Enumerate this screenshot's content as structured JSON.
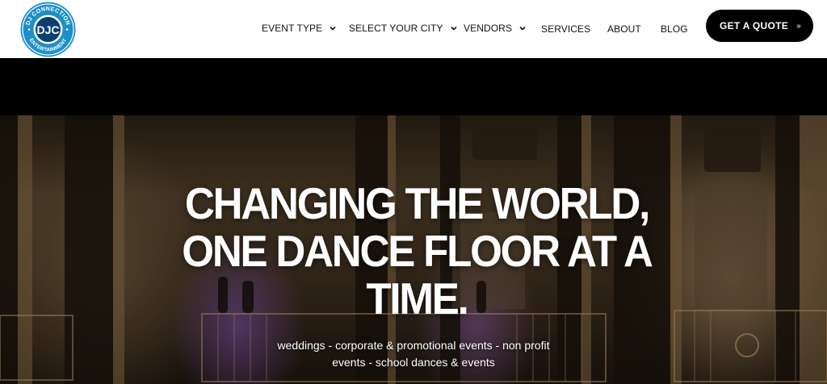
{
  "brand": {
    "logo_text_top": "DJ CONNECTION",
    "logo_text_bottom": "ENTERTAINMENT",
    "logo_monogram": "DJC",
    "color_primary": "#1e8fc9",
    "color_dark": "#0b3f73"
  },
  "nav": {
    "items": [
      {
        "label": "EVENT TYPE",
        "has_dropdown": true
      },
      {
        "label": "SELECT YOUR CITY",
        "has_dropdown": true
      },
      {
        "label": "VENDORS",
        "has_dropdown": true
      },
      {
        "label": "SERVICES",
        "has_dropdown": false
      },
      {
        "label": "ABOUT",
        "has_dropdown": false
      },
      {
        "label": "BLOG",
        "has_dropdown": false
      }
    ],
    "cta_label": "GET A QUOTE",
    "cta_icon": "double-chevron-right-icon"
  },
  "hero": {
    "title": "CHANGING THE WORLD, ONE DANCE FLOOR AT A TIME.",
    "subtitle": "weddings - corporate & promotional events - non profit events - school dances & events"
  }
}
